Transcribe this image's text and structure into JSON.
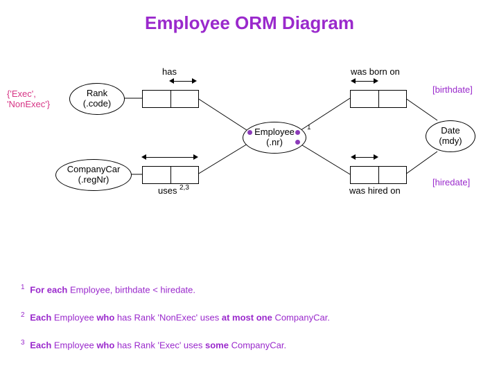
{
  "title": "Employee ORM Diagram",
  "entities": {
    "rank": {
      "name": "Rank",
      "ref": "(.code)"
    },
    "companyCar": {
      "name": "CompanyCar",
      "ref": "(.regNr)"
    },
    "employee": {
      "name": "Employee",
      "ref": "(.nr)",
      "sup": "1"
    },
    "date": {
      "name": "Date",
      "ref": "(mdy)"
    }
  },
  "predicates": {
    "has": "has",
    "uses": "uses",
    "uses_sup": "2,3",
    "born": "was born on",
    "hired": "was hired on"
  },
  "constraints": {
    "rankValues": "{'Exec', 'NonExec'}",
    "birthdate": "[birthdate]",
    "hiredate": "[hiredate]"
  },
  "footnotes": {
    "f1": {
      "n": "1",
      "pre": "For each",
      "mid": " Employee, birthdate < hiredate."
    },
    "f2": {
      "n": "2",
      "a": "Each",
      "b": " Employee ",
      "c": "who",
      "d": " has Rank 'NonExec' uses ",
      "e": "at most one",
      "f": " CompanyCar."
    },
    "f3": {
      "n": "3",
      "a": "Each",
      "b": " Employee ",
      "c": "who",
      "d": " has Rank 'Exec' uses ",
      "e": "some",
      "f": " CompanyCar."
    }
  }
}
